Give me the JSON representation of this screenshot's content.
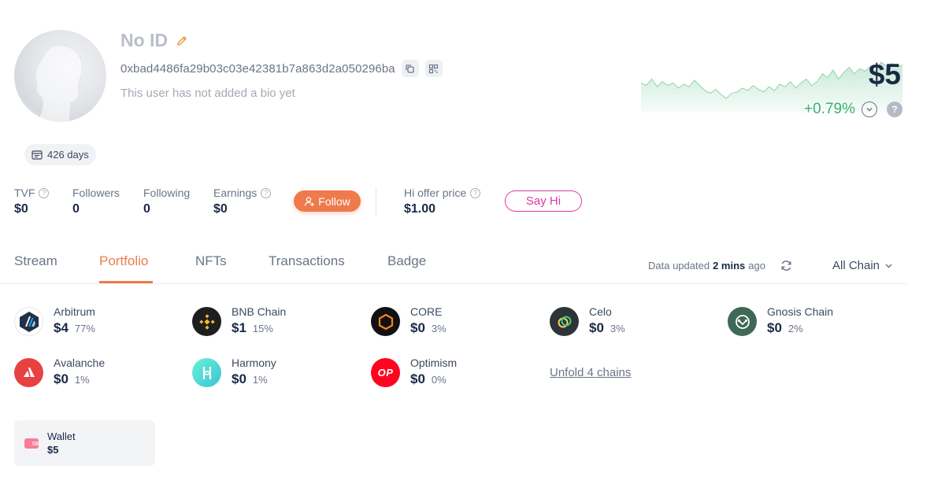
{
  "profile": {
    "name": "No ID",
    "address": "0xbad4486fa29b03c03e42381b7a863d2a050296ba",
    "bio": "This user has not added a bio yet",
    "days": "426 days"
  },
  "value": {
    "net_worth": "$5",
    "change": "+0.79%"
  },
  "chart_data": {
    "type": "area",
    "series": [
      {
        "values": [
          3.6,
          3.4,
          3.9,
          3.3,
          3.7,
          3.4,
          3.6,
          3.2,
          3.5,
          3.3,
          3.8,
          3.4,
          3.0,
          2.8,
          3.1,
          2.7,
          2.4,
          2.8,
          2.9,
          3.2,
          3.0,
          3.4,
          3.1,
          2.9,
          3.3,
          3.0,
          3.5,
          3.3,
          3.7,
          3.2,
          3.6,
          3.9,
          3.4,
          3.7,
          4.3,
          4.0,
          4.6,
          3.9,
          4.4,
          4.8,
          4.3,
          4.7,
          4.5,
          4.9,
          4.4,
          5.2,
          4.9,
          5.1,
          4.8,
          5.0
        ]
      }
    ],
    "color": "#3bb175"
  },
  "stats": {
    "tvf": {
      "label": "TVF",
      "value": "$0"
    },
    "followers": {
      "label": "Followers",
      "value": "0"
    },
    "following": {
      "label": "Following",
      "value": "0"
    },
    "earnings": {
      "label": "Earnings",
      "value": "$0"
    },
    "hi_offer": {
      "label": "Hi offer price",
      "value": "$1.00"
    }
  },
  "buttons": {
    "follow": "Follow",
    "say_hi": "Say Hi"
  },
  "tabs": [
    "Stream",
    "Portfolio",
    "NFTs",
    "Transactions",
    "Badge"
  ],
  "active_tab": "Portfolio",
  "data_updated": {
    "prefix": "Data updated",
    "time": "2 mins",
    "suffix": "ago"
  },
  "chain_filter": "All Chain",
  "chains": [
    {
      "name": "Arbitrum",
      "value": "$4",
      "pct": "77%",
      "icon": "arbitrum-icon"
    },
    {
      "name": "BNB Chain",
      "value": "$1",
      "pct": "15%",
      "icon": "bnb-icon"
    },
    {
      "name": "CORE",
      "value": "$0",
      "pct": "3%",
      "icon": "core-icon"
    },
    {
      "name": "Celo",
      "value": "$0",
      "pct": "3%",
      "icon": "celo-icon"
    },
    {
      "name": "Gnosis Chain",
      "value": "$0",
      "pct": "2%",
      "icon": "gnosis-icon"
    },
    {
      "name": "Avalanche",
      "value": "$0",
      "pct": "1%",
      "icon": "avalanche-icon"
    },
    {
      "name": "Harmony",
      "value": "$0",
      "pct": "1%",
      "icon": "harmony-icon"
    },
    {
      "name": "Optimism",
      "value": "$0",
      "pct": "0%",
      "icon": "optimism-icon"
    }
  ],
  "unfold_label": "Unfold 4 chains",
  "wallet": {
    "label": "Wallet",
    "value": "$5"
  },
  "colors": {
    "accent": "#ef7a4b",
    "positive": "#3bb175",
    "say_hi": "#d73aa7"
  }
}
